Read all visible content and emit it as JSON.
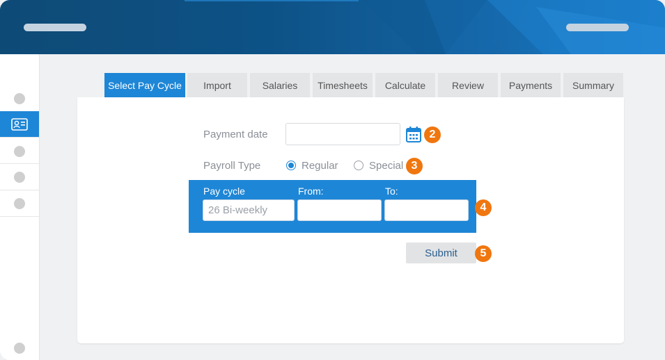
{
  "colors": {
    "accent": "#1e86d6",
    "header_dark": "#0e4a76",
    "badge": "#f0760f",
    "tab_inactive": "#e4e5e7"
  },
  "sidebar": {
    "active_icon": "id-card-icon"
  },
  "tabs": [
    {
      "label": "Select Pay Cycle",
      "active": true
    },
    {
      "label": "Import",
      "active": false
    },
    {
      "label": "Salaries",
      "active": false
    },
    {
      "label": "Timesheets",
      "active": false
    },
    {
      "label": "Calculate",
      "active": false
    },
    {
      "label": "Review",
      "active": false
    },
    {
      "label": "Payments",
      "active": false
    },
    {
      "label": "Summary",
      "active": false
    }
  ],
  "form": {
    "payment_date_label": "Payment date",
    "payment_date_value": "",
    "payroll_type_label": "Payroll Type",
    "payroll_options": [
      {
        "label": "Regular",
        "selected": true
      },
      {
        "label": "Special",
        "selected": false
      }
    ],
    "pay_cycle_label": "Pay cycle",
    "pay_cycle_value": "26 Bi-weekly",
    "from_label": "From:",
    "from_value": "",
    "to_label": "To:",
    "to_value": "",
    "submit_label": "Submit"
  },
  "badges": {
    "date": "2",
    "payroll": "3",
    "cycle": "4",
    "submit": "5"
  }
}
